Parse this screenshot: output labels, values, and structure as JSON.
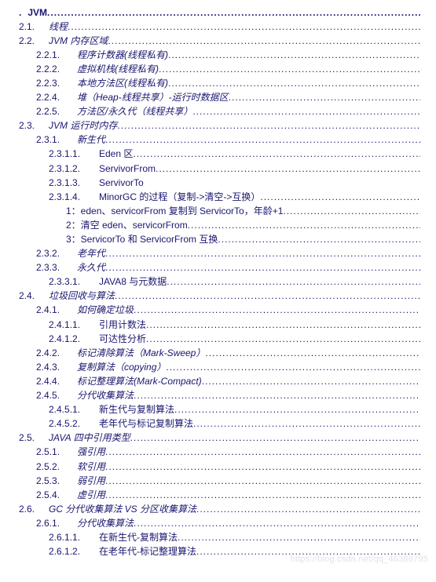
{
  "watermark": "https://blog.csdn.net/qq_46388795",
  "toc": [
    {
      "lvl": 0,
      "num": ".",
      "title": "JVM",
      "dots": true,
      "italic": false
    },
    {
      "lvl": 1,
      "num": "2.1.",
      "title": "线程",
      "dots": true
    },
    {
      "lvl": 1,
      "num": "2.2.",
      "title": "JVM 内存区域",
      "dots": true
    },
    {
      "lvl": 2,
      "num": "2.2.1.",
      "title": "程序计数器(线程私有)",
      "dots": true
    },
    {
      "lvl": 2,
      "num": "2.2.2.",
      "title": "虚拟机栈(线程私有)",
      "dots": true
    },
    {
      "lvl": 2,
      "num": "2.2.3.",
      "title": "本地方法区(线程私有)",
      "dots": true
    },
    {
      "lvl": 2,
      "num": "2.2.4.",
      "title": "堆（Heap-线程共享）-运行时数据区",
      "dots": true
    },
    {
      "lvl": 2,
      "num": "2.2.5.",
      "title": "方法区/永久代（线程共享）",
      "dots": true
    },
    {
      "lvl": 1,
      "num": "2.3.",
      "title": "JVM 运行时内存",
      "dots": true
    },
    {
      "lvl": 2,
      "num": "2.3.1.",
      "title": "新生代",
      "dots": true
    },
    {
      "lvl": 3,
      "num": "2.3.1.1.",
      "title": "Eden 区",
      "dots": true
    },
    {
      "lvl": 3,
      "num": "2.3.1.2.",
      "title": "ServivorFrom",
      "dots": true
    },
    {
      "lvl": 3,
      "num": "2.3.1.3.",
      "title": "ServivorTo",
      "dots": false
    },
    {
      "lvl": 3,
      "num": "2.3.1.4.",
      "title": "MinorGC 的过程（复制->清空->互换）",
      "dots": true
    },
    {
      "lvl": "plain",
      "num": "",
      "title": "1：eden、servicorFrom 复制到 ServicorTo，年龄+1",
      "dots": true
    },
    {
      "lvl": "plain",
      "num": "",
      "title": "2：清空 eden、servicorFrom",
      "dots": true
    },
    {
      "lvl": "plain",
      "num": "",
      "title": "3：ServicorTo 和 ServicorFrom 互换",
      "dots": true
    },
    {
      "lvl": 2,
      "num": "2.3.2.",
      "title": "老年代",
      "dots": true
    },
    {
      "lvl": 2,
      "num": "2.3.3.",
      "title": "永久代",
      "dots": true
    },
    {
      "lvl": 3,
      "num": "2.3.3.1.",
      "title": "JAVA8 与元数据",
      "dots": true
    },
    {
      "lvl": 1,
      "num": "2.4.",
      "title": "垃圾回收与算法",
      "dots": true
    },
    {
      "lvl": 2,
      "num": "2.4.1.",
      "title": "如何确定垃圾",
      "dots": true
    },
    {
      "lvl": 3,
      "num": "2.4.1.1.",
      "title": "引用计数法",
      "dots": true
    },
    {
      "lvl": 3,
      "num": "2.4.1.2.",
      "title": "可达性分析",
      "dots": true
    },
    {
      "lvl": 2,
      "num": "2.4.2.",
      "title": "标记清除算法（Mark-Sweep）",
      "dots": true
    },
    {
      "lvl": 2,
      "num": "2.4.3.",
      "title": "复制算法（copying）",
      "dots": true
    },
    {
      "lvl": 2,
      "num": "2.4.4.",
      "title": "标记整理算法(Mark-Compact)",
      "dots": true
    },
    {
      "lvl": 2,
      "num": "2.4.5.",
      "title": "分代收集算法",
      "dots": true
    },
    {
      "lvl": 3,
      "num": "2.4.5.1.",
      "title": "新生代与复制算法",
      "dots": true
    },
    {
      "lvl": 3,
      "num": "2.4.5.2.",
      "title": "老年代与标记复制算法",
      "dots": true
    },
    {
      "lvl": 1,
      "num": "2.5.",
      "title": "JAVA 四中引用类型",
      "dots": true
    },
    {
      "lvl": 2,
      "num": "2.5.1.",
      "title": "强引用",
      "dots": true
    },
    {
      "lvl": 2,
      "num": "2.5.2.",
      "title": "软引用",
      "dots": true
    },
    {
      "lvl": 2,
      "num": "2.5.3.",
      "title": "弱引用",
      "dots": true
    },
    {
      "lvl": 2,
      "num": "2.5.4.",
      "title": "虚引用",
      "dots": true
    },
    {
      "lvl": 1,
      "num": "2.6.",
      "title": "GC 分代收集算法 VS 分区收集算法",
      "dots": true
    },
    {
      "lvl": 2,
      "num": "2.6.1.",
      "title": "分代收集算法",
      "dots": true
    },
    {
      "lvl": 3,
      "num": "2.6.1.1.",
      "title": "在新生代-复制算法",
      "dots": true
    },
    {
      "lvl": 3,
      "num": "2.6.1.2.",
      "title": "在老年代-标记整理算法",
      "dots": true
    }
  ]
}
